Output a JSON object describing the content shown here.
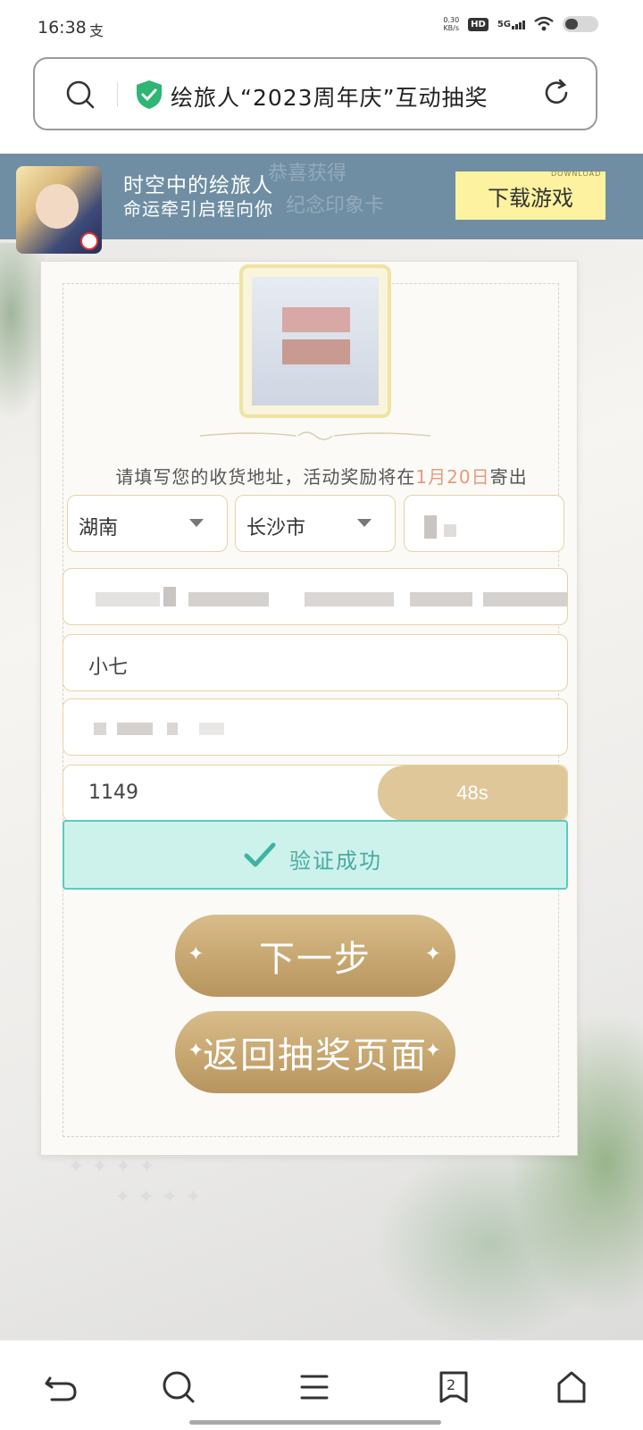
{
  "status_bar": {
    "time": "16:38",
    "notification_icon": "支",
    "net_speed_value": "0.30",
    "net_speed_unit": "KB/s",
    "hd": "HD",
    "network": "5G"
  },
  "url_bar": {
    "title": "绘旅人“2023周年庆”互动抽奖"
  },
  "banner": {
    "ghost_text": "恭喜获得",
    "ghost_text2": "纪念印象卡",
    "title": "时空中的绘旅人",
    "subtitle": "命运牵引启程向你",
    "download_label": "下载游戏",
    "download_small": "DOWNLOAD"
  },
  "form": {
    "notice_prefix": "请填写您的收货地址，活动奖励将在",
    "notice_date": "1月20日",
    "notice_suffix": "寄出",
    "province": "湖南",
    "city": "长沙市",
    "name": "小七",
    "code": "1149",
    "countdown": "48s",
    "verify_text": "验证成功"
  },
  "buttons": {
    "next": "下一步",
    "back": "返回抽奖页面"
  },
  "bottom_nav": {
    "tab_count": "2"
  },
  "colors": {
    "banner_bg": "#6f8ea3",
    "download_bg": "#fdf2a0",
    "accent_gold": "#c7a670",
    "verify_bg": "#cdf2ec",
    "verify_border": "#5ccbbb",
    "date_highlight": "#e79a7e"
  }
}
